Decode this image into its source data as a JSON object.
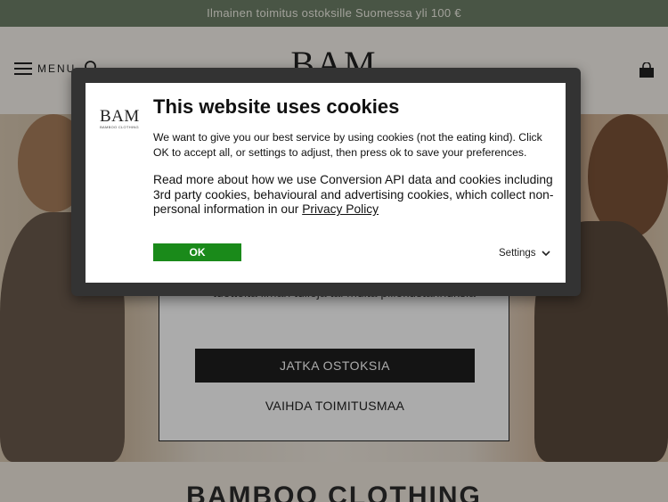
{
  "announcement": {
    "text": "Ilmainen toimitus ostoksille Suomessa yli 100 €"
  },
  "header": {
    "menu_label": "MENU",
    "logo_text": "BAM"
  },
  "country_modal": {
    "text": "tuotteita ilman tulleja tai muita piilokustannuksia",
    "continue_label": "JATKA OSTOKSIA",
    "change_label": "VAIHDA TOIMITUSMAA"
  },
  "section": {
    "title": "BAMBOO CLOTHING"
  },
  "cookie": {
    "logo_word": "BAM",
    "logo_sub": "BAMBOO CLOTHING",
    "title": "This website uses cookies",
    "intro": "We want to give you our best service by using cookies (not the eating kind). Click OK to accept all, or settings to adjust, then press ok to save your preferences.",
    "details_prefix": "Read more about how we use Conversion API data and cookies including 3rd party cookies, behavioural and advertising cookies, which collect non-personal information in our ",
    "privacy_link": "Privacy Policy",
    "ok_label": "OK",
    "settings_label": "Settings",
    "colors": {
      "ok_button": "#1a8a1a",
      "frame": "#333333"
    }
  },
  "icons": [
    "hamburger-icon",
    "search-icon",
    "bag-icon",
    "chevron-down-icon"
  ]
}
